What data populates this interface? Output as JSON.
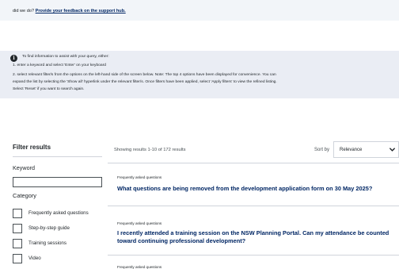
{
  "feedback_banner": {
    "prefix": "did we do?",
    "link": "Provide your feedback on the support hub."
  },
  "info_box": {
    "heading": "To find information to assist with your query, either:",
    "step1": "1. enter a keyword and select 'Enter' on your keyboard",
    "step2_line1": "2. select relevant filter/s from the options on the left-hand side of the screen below. Note: The top 4 options have been displayed for convenience. You can",
    "step2_line2": "expand the list by selecting the 'Show all' hyperlink under the relevant filter/s. Once filters have been applied, select 'Apply filters' to view the refined listing.",
    "step2_line3": "Select 'Reset' if you want to search again."
  },
  "filters": {
    "title": "Filter results",
    "keyword_label": "Keyword",
    "keyword_value": "",
    "category_label": "Category",
    "categories": [
      {
        "label": "Frequently asked questions",
        "checked": false
      },
      {
        "label": "Step-by-step guide",
        "checked": false
      },
      {
        "label": "Training sessions",
        "checked": false
      },
      {
        "label": "Video",
        "checked": false
      }
    ]
  },
  "results_header": {
    "count_text": "Showing results 1-10 of 172 results",
    "sort_label": "Sort by",
    "sort_value": "Relevance"
  },
  "results": [
    {
      "kicker": "Frequently asked questions",
      "title": "What questions are being removed from the development application form on 30 May 2025?"
    },
    {
      "kicker": "Frequently asked questions",
      "title": "I recently attended a training session on the NSW Planning Portal. Can my attendance be counted toward continuing professional development?"
    },
    {
      "kicker": "Frequently asked questions",
      "title": ""
    }
  ],
  "icons": {
    "info": "info-icon",
    "sort_chevron": "chevron-down-icon"
  },
  "colors": {
    "link_navy": "#002664",
    "info_bg": "#eaedf4",
    "banner_bg": "#f2f5f9"
  }
}
